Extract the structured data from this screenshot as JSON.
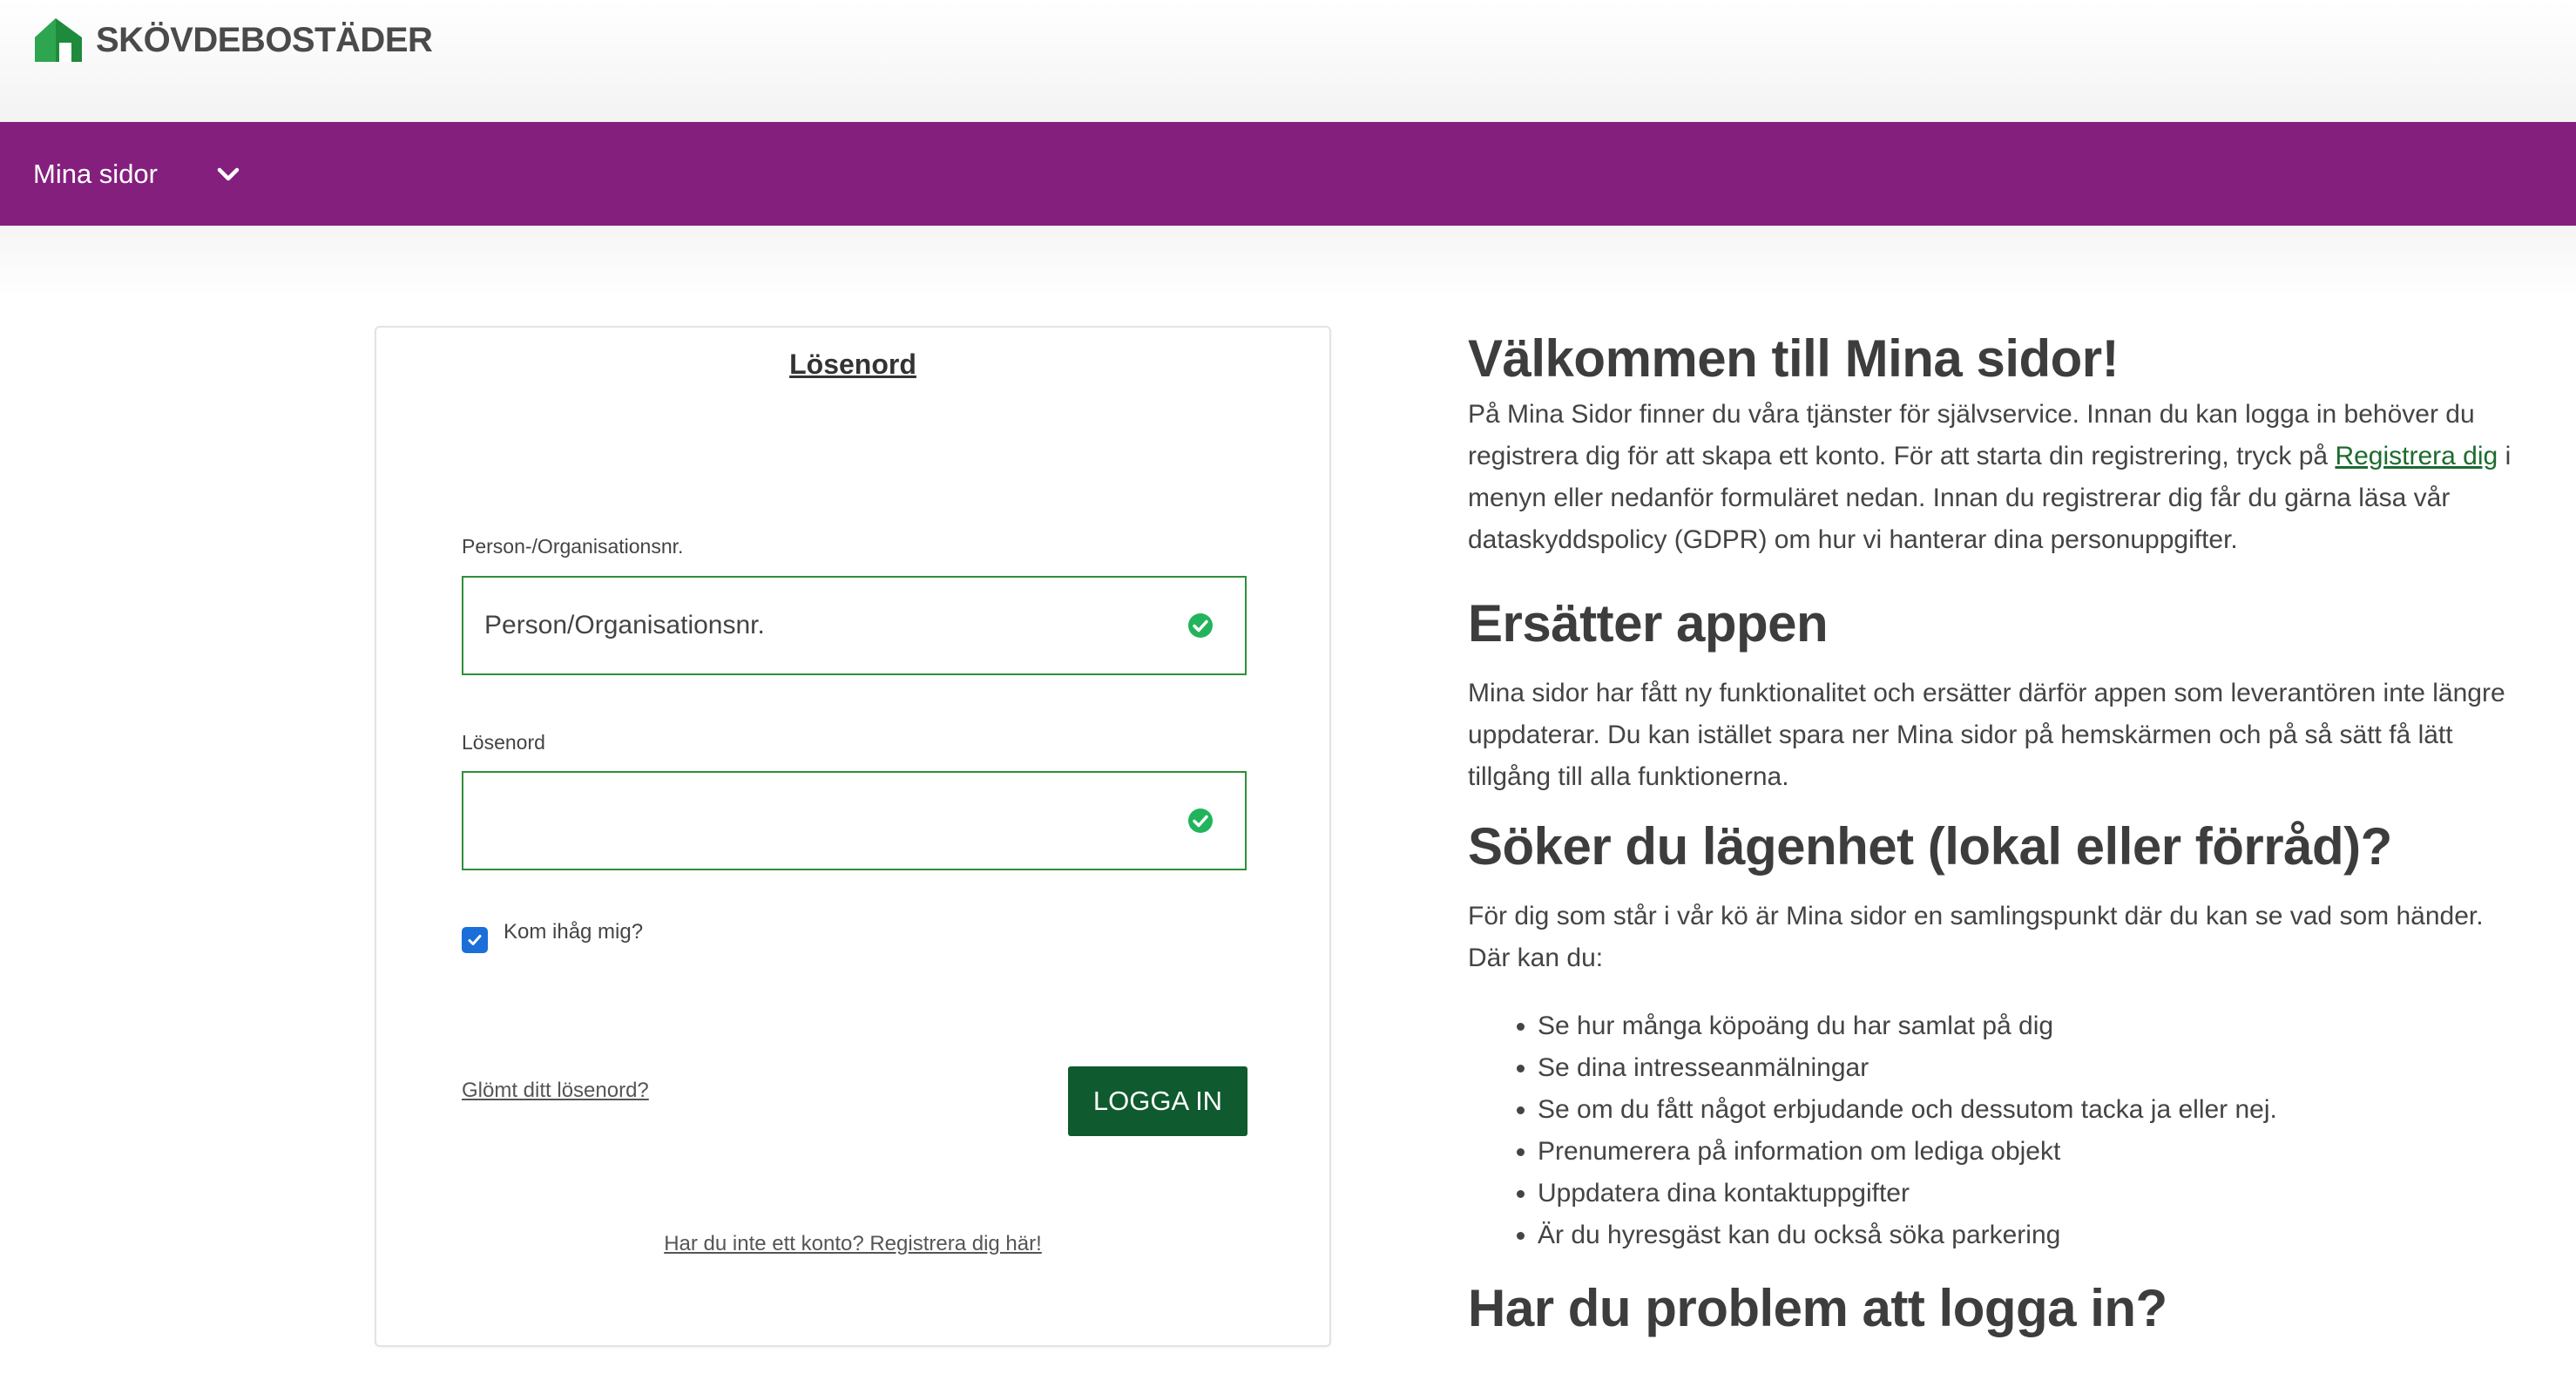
{
  "header": {
    "logo_text": "SKÖVDEBOSTÄDER",
    "logo_icon": "house-icon",
    "brand_color": "#1e8a3c"
  },
  "navbar": {
    "bg_color": "#841f7e",
    "item_label": "Mina sidor",
    "item_icon": "chevron-down-icon"
  },
  "login": {
    "title": "Lösenord",
    "id_label": "Person-/Organisationsnr.",
    "id_placeholder": "Person/Organisationsnr.",
    "password_label": "Lösenord",
    "password_value": "",
    "remember_label": "Kom ihåg mig?",
    "remember_checked": true,
    "forgot_label": "Glömt ditt lösenord?",
    "login_button": "LOGGA IN",
    "register_label": "Har du inte ett konto? Registrera dig här!"
  },
  "info": {
    "welcome_heading": "Välkommen till Mina sidor!",
    "welcome_text_1": "På Mina Sidor finner du våra tjänster för självservice. Innan du kan logga in behöver du registrera dig för att skapa ett konto. För att starta din registrering, tryck på",
    "welcome_link": "Registrera dig",
    "welcome_text_2": "i menyn eller nedanför formuläret nedan. Innan du registrerar dig får du gärna läsa vår dataskyddspolicy (GDPR) om hur vi hanterar dina personuppgifter.",
    "app_heading": "Ersätter appen",
    "app_text": "Mina sidor har fått ny funktionalitet och ersätter därför appen som leverantören inte längre uppdaterar. Du kan istället spara ner Mina sidor på hemskärmen och på så sätt få lätt tillgång till alla funktionerna.",
    "apartment_heading": "Söker du lägenhet (lokal eller förråd)?",
    "apartment_text": "För dig som står i vår kö är Mina sidor en samlingspunkt där du kan se vad som händer.  Där kan du:",
    "apartment_items": [
      "Se hur många köpoäng du har samlat på dig",
      "Se dina intresseanmälningar",
      "Se om du fått något erbjudande och dessutom tacka ja eller nej.",
      "Prenumerera på information om lediga objekt",
      "Uppdatera dina kontaktuppgifter",
      "Är du hyresgäst kan du också söka parkering"
    ],
    "problem_heading": "Har du problem att logga in?"
  }
}
